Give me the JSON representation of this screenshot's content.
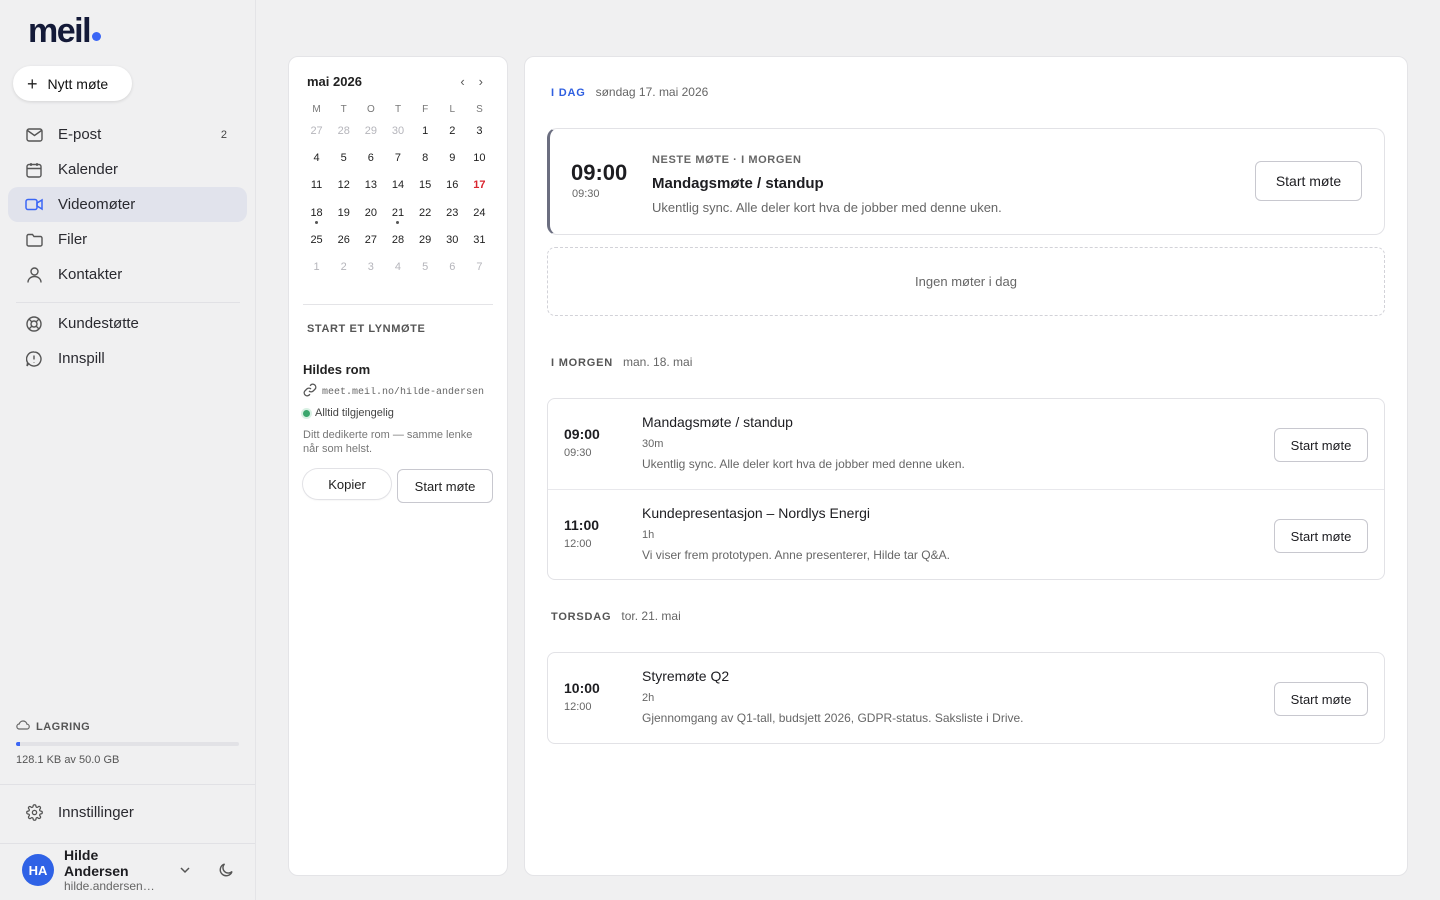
{
  "app": {
    "logo_text": "meil"
  },
  "sidebar": {
    "new_meeting_label": "Nytt møte",
    "items": [
      {
        "label": "E-post",
        "icon": "mail-icon",
        "badge": "2"
      },
      {
        "label": "Kalender",
        "icon": "calendar-icon"
      },
      {
        "label": "Videomøter",
        "icon": "video-icon",
        "active": true
      },
      {
        "label": "Filer",
        "icon": "folder-icon"
      },
      {
        "label": "Kontakter",
        "icon": "user-icon"
      }
    ],
    "items2": [
      {
        "label": "Kundestøtte",
        "icon": "lifebuoy-icon"
      },
      {
        "label": "Innspill",
        "icon": "feedback-icon"
      }
    ],
    "storage": {
      "label": "LAGRING",
      "text": "128.1 KB av 50.0 GB",
      "fraction": 2.6e-06
    },
    "settings_label": "Innstillinger",
    "user": {
      "initials": "HA",
      "name": "Hilde Andersen",
      "email": "hilde.andersen@..."
    }
  },
  "calendar": {
    "month_label": "mai 2026",
    "prev": "‹",
    "next": "›",
    "weekdays": [
      "M",
      "T",
      "O",
      "T",
      "F",
      "L",
      "S"
    ],
    "weeks": [
      [
        {
          "d": "27",
          "m": true
        },
        {
          "d": "28",
          "m": true
        },
        {
          "d": "29",
          "m": true
        },
        {
          "d": "30",
          "m": true
        },
        {
          "d": "1"
        },
        {
          "d": "2"
        },
        {
          "d": "3"
        }
      ],
      [
        {
          "d": "4"
        },
        {
          "d": "5"
        },
        {
          "d": "6"
        },
        {
          "d": "7"
        },
        {
          "d": "8"
        },
        {
          "d": "9"
        },
        {
          "d": "10"
        }
      ],
      [
        {
          "d": "11"
        },
        {
          "d": "12"
        },
        {
          "d": "13"
        },
        {
          "d": "14"
        },
        {
          "d": "15"
        },
        {
          "d": "16"
        },
        {
          "d": "17",
          "today": true
        }
      ],
      [
        {
          "d": "18",
          "dot": true
        },
        {
          "d": "19"
        },
        {
          "d": "20"
        },
        {
          "d": "21",
          "dot": true
        },
        {
          "d": "22"
        },
        {
          "d": "23"
        },
        {
          "d": "24"
        }
      ],
      [
        {
          "d": "25"
        },
        {
          "d": "26"
        },
        {
          "d": "27"
        },
        {
          "d": "28"
        },
        {
          "d": "29"
        },
        {
          "d": "30"
        },
        {
          "d": "31"
        }
      ],
      [
        {
          "d": "1",
          "m": true
        },
        {
          "d": "2",
          "m": true
        },
        {
          "d": "3",
          "m": true
        },
        {
          "d": "4",
          "m": true
        },
        {
          "d": "5",
          "m": true
        },
        {
          "d": "6",
          "m": true
        },
        {
          "d": "7",
          "m": true
        }
      ]
    ],
    "quick_title": "START ET LYNMØTE",
    "room_name": "Hildes rom",
    "room_link": "meet.meil.no/hilde-andersen",
    "availability": "Alltid tilgjengelig",
    "room_desc": "Ditt dedikerte rom — samme lenke når som helst.",
    "copy_label": "Kopier",
    "start_label": "Start møte"
  },
  "main": {
    "today": {
      "tag": "I DAG",
      "date": "søndag 17. mai 2026"
    },
    "next_meeting": {
      "start": "09:00",
      "end": "09:30",
      "eyebrow": "NESTE MØTE · I MORGEN",
      "title": "Mandagsmøte / standup",
      "desc": "Ukentlig sync. Alle deler kort hva de jobber med denne uken.",
      "button": "Start møte"
    },
    "empty_text": "Ingen møter i dag",
    "groups": [
      {
        "tag": "I MORGEN",
        "date": "man. 18. mai",
        "events": [
          {
            "start": "09:00",
            "end": "09:30",
            "title": "Mandagsmøte / standup",
            "duration": "30m",
            "desc": "Ukentlig sync. Alle deler kort hva de jobber med denne uken.",
            "button": "Start møte"
          },
          {
            "start": "11:00",
            "end": "12:00",
            "title": "Kundepresentasjon – Nordlys Energi",
            "duration": "1h",
            "desc": "Vi viser frem prototypen. Anne presenterer, Hilde tar Q&A.",
            "button": "Start møte"
          }
        ]
      },
      {
        "tag": "TORSDAG",
        "date": "tor. 21. mai",
        "events": [
          {
            "start": "10:00",
            "end": "12:00",
            "title": "Styremøte Q2",
            "duration": "2h",
            "desc": "Gjennomgang av Q1-tall, budsjett 2026, GDPR-status. Saksliste i Drive.",
            "button": "Start møte"
          }
        ]
      }
    ]
  }
}
